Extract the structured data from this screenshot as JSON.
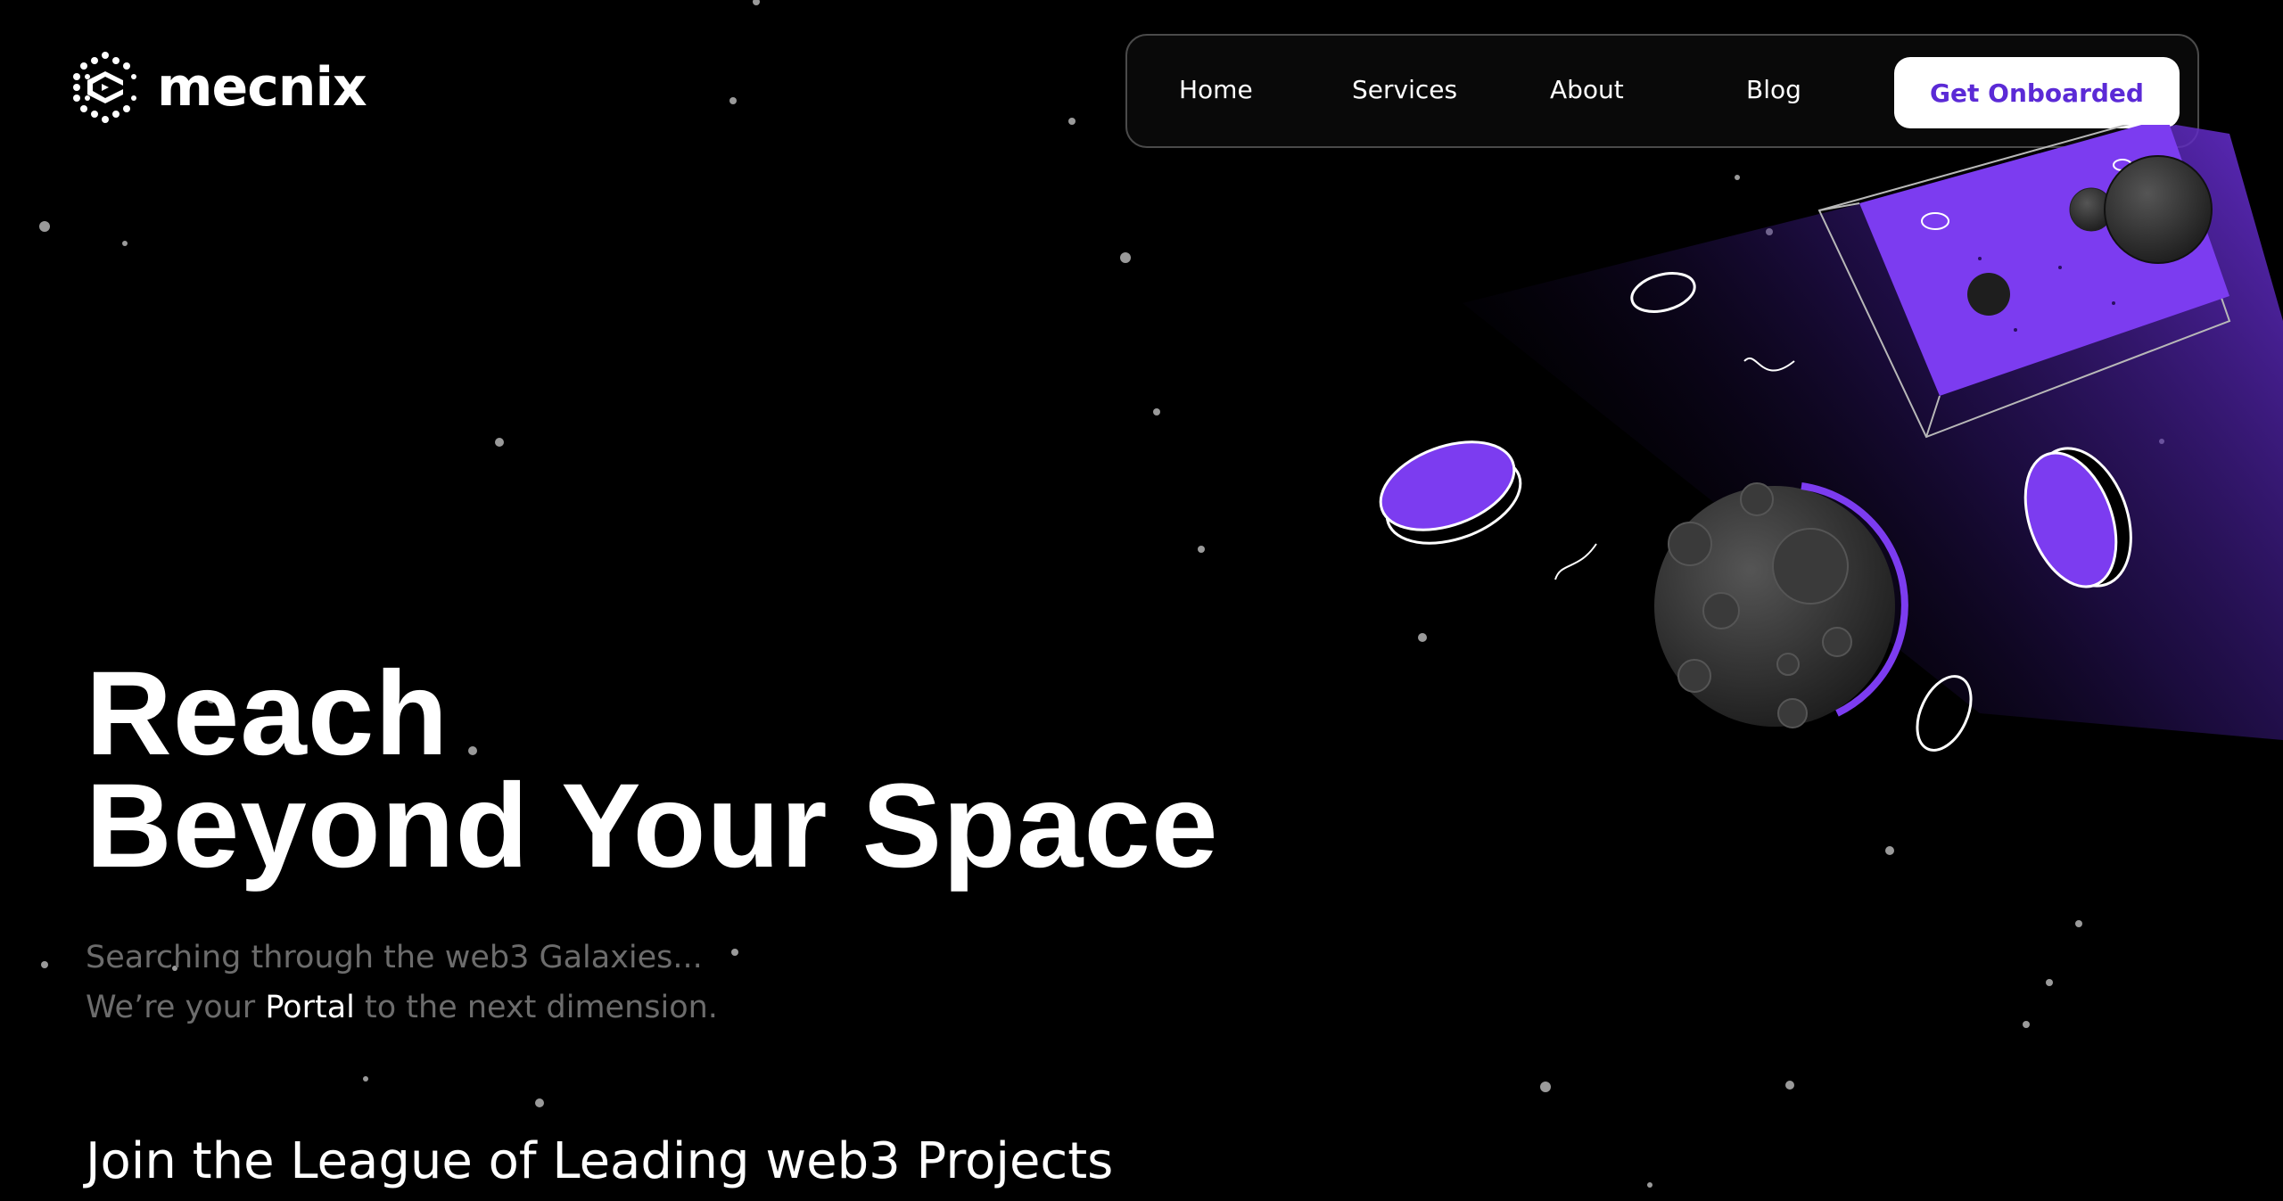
{
  "brand": {
    "name": "mecnix",
    "logo_icon": "hexagon-dots-logo-icon"
  },
  "nav": {
    "items": [
      "Home",
      "Services",
      "About",
      "Blog"
    ],
    "cta_label": "Get Onboarded"
  },
  "hero": {
    "title_line1": "Reach",
    "title_line2": "Beyond Your Space",
    "sub_line1": "Searching through the web3 Galaxies...",
    "sub_line2_before": "We’re your ",
    "sub_line2_highlight": "Portal",
    "sub_line2_after": " to the next dimension."
  },
  "league": {
    "title": "Join the League of Leading web3 Projects"
  },
  "colors": {
    "background": "#000000",
    "accent": "#7b3cf5",
    "cta_text": "#5b2ad6",
    "muted_text": "#6c6c6c"
  }
}
